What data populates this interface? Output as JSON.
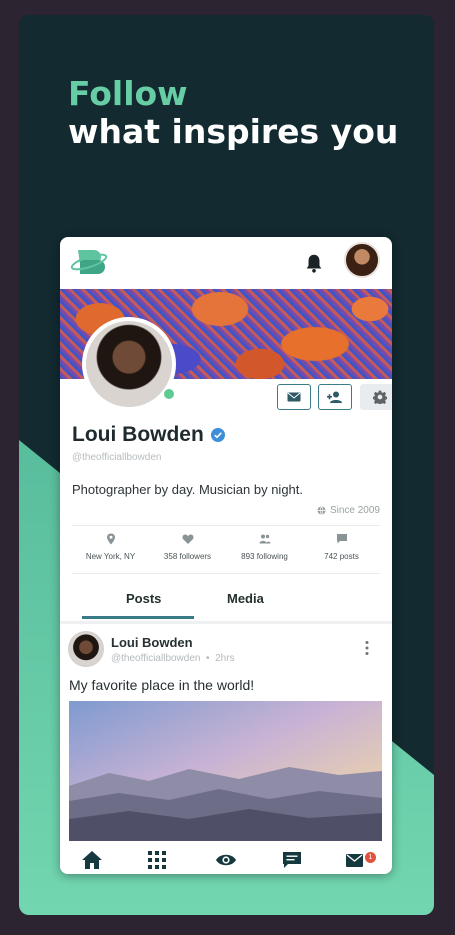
{
  "promo": {
    "headline_accent": "Follow",
    "headline_rest": "what inspires you",
    "colors": {
      "background": "#122a30",
      "accent": "#67cda5",
      "teal_band": "#5ec4a0"
    }
  },
  "app": {
    "icons": {
      "logo": "app-logo-icon",
      "notifications": "bell-icon",
      "user_avatar": "avatar"
    },
    "profile": {
      "name": "Loui Bowden",
      "handle": "@theofficiallbowden",
      "verified": true,
      "online": true,
      "bio": "Photographer by day. Musician by night.",
      "since": "Since 2009",
      "actions": [
        {
          "name": "message",
          "icon": "envelope-icon"
        },
        {
          "name": "follow",
          "icon": "add-user-icon"
        },
        {
          "name": "settings",
          "icon": "gear-icon"
        }
      ]
    },
    "stats": [
      {
        "icon": "location-pin-icon",
        "label": "New York, NY"
      },
      {
        "icon": "heart-icon",
        "label": "358 followers"
      },
      {
        "icon": "people-icon",
        "label": "893 following"
      },
      {
        "icon": "chat-icon",
        "label": "742 posts"
      }
    ],
    "tabs": [
      {
        "label": "Posts",
        "active": true
      },
      {
        "label": "Media",
        "active": false
      }
    ],
    "post": {
      "author": "Loui Bowden",
      "handle": "@theofficiallbowden",
      "time": "2hrs",
      "text": "My favorite place in the world!"
    },
    "bottom_nav": [
      {
        "icon": "home-icon",
        "active": true
      },
      {
        "icon": "grid-icon"
      },
      {
        "icon": "eye-icon"
      },
      {
        "icon": "chat-bubble-icon"
      },
      {
        "icon": "mail-icon",
        "badge": "1"
      }
    ]
  }
}
